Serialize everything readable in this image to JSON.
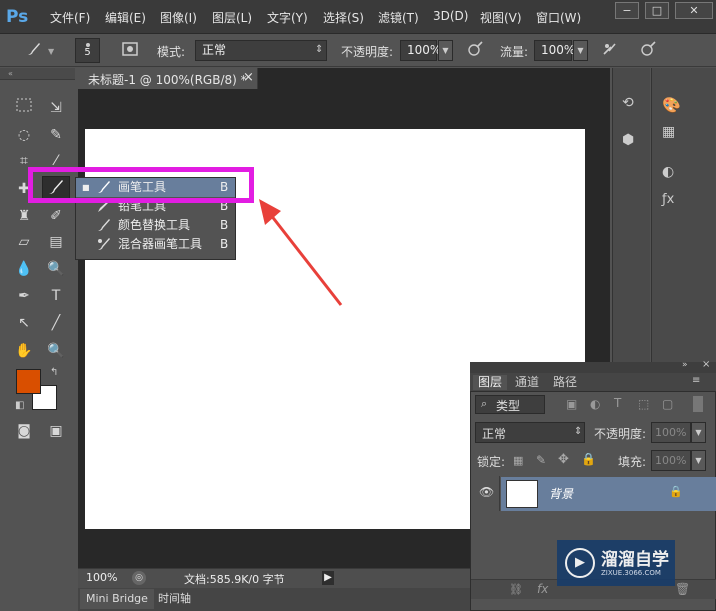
{
  "app": {
    "logo": "Ps"
  },
  "menu": [
    "文件(F)",
    "编辑(E)",
    "图像(I)",
    "图层(L)",
    "文字(Y)",
    "选择(S)",
    "滤镜(T)",
    "3D(D)",
    "视图(V)",
    "窗口(W)"
  ],
  "window_controls": [
    "−",
    "□",
    "✕"
  ],
  "options_bar": {
    "brush_size": "5",
    "mode_label": "模式:",
    "mode_value": "正常",
    "opacity_label": "不透明度:",
    "opacity_value": "100%",
    "flow_label": "流量:",
    "flow_value": "100%"
  },
  "document": {
    "tab_title": "未标题-1 @ 100%(RGB/8) *",
    "close": "×"
  },
  "status": {
    "zoom": "100%",
    "doc_info": "文档:585.9K/0 字节"
  },
  "bottom_tabs": [
    "Mini Bridge",
    "时间轴"
  ],
  "flyout": {
    "items": [
      {
        "label": "画笔工具",
        "shortcut": "B",
        "selected": true
      },
      {
        "label": "铅笔工具",
        "shortcut": "B",
        "selected": false
      },
      {
        "label": "颜色替换工具",
        "shortcut": "B",
        "selected": false
      },
      {
        "label": "混合器画笔工具",
        "shortcut": "B",
        "selected": false
      }
    ]
  },
  "colors": {
    "foreground": "#d94f00",
    "background": "#ffffff",
    "highlight": "#e21de2",
    "arrow": "#e8403a",
    "selection": "#687e9c"
  },
  "layers_panel": {
    "tabs": [
      "图层",
      "通道",
      "路径"
    ],
    "filter_label": "类型",
    "blend_mode": "正常",
    "opacity_label": "不透明度:",
    "opacity_value": "100%",
    "lock_label": "锁定:",
    "fill_label": "填充:",
    "fill_value": "100%",
    "layer_name": "背景"
  },
  "watermark": {
    "title": "溜溜自学",
    "url": "ZIXUE.3066.COM"
  }
}
